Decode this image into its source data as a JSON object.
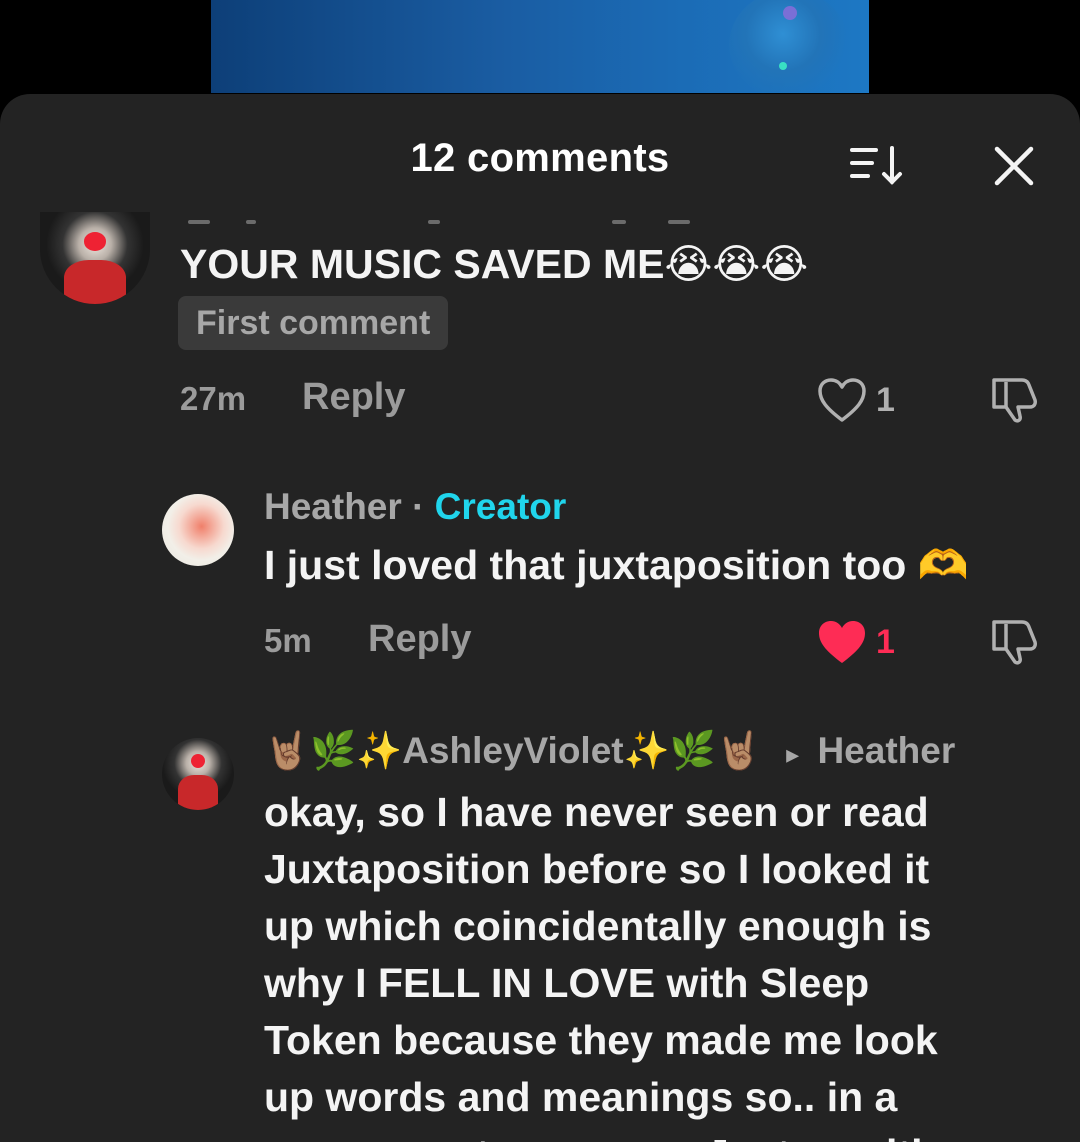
{
  "header": {
    "title": "12 comments"
  },
  "comments": [
    {
      "text": "YOUR MUSIC SAVED ME😭😭😭",
      "badge": "First comment",
      "time": "27m",
      "reply": "Reply",
      "likes": "1",
      "liked": false
    },
    {
      "username": "Heather",
      "separator": "·",
      "role": "Creator",
      "text": "I just loved that juxtaposition too 🫶",
      "time": "5m",
      "reply": "Reply",
      "likes": "1",
      "liked": true
    },
    {
      "username": "🤘🏽🌿✨AshleyViolet✨🌿🤘🏽",
      "reply_arrow": "▸",
      "reply_to": "Heather",
      "lines": [
        "okay, so I have never seen or read",
        "Juxtaposition before so I looked it",
        "up which coincidentally enough is",
        "why I FELL IN LOVE with Sleep",
        "Token because they made me look",
        "up words and meanings so.. in a",
        "sense you too, are my Juxtaposition"
      ]
    }
  ],
  "colors": {
    "sheet": "#232323",
    "creator": "#20d5ec",
    "liked": "#fe2c55",
    "muted": "#9b9b9b"
  }
}
